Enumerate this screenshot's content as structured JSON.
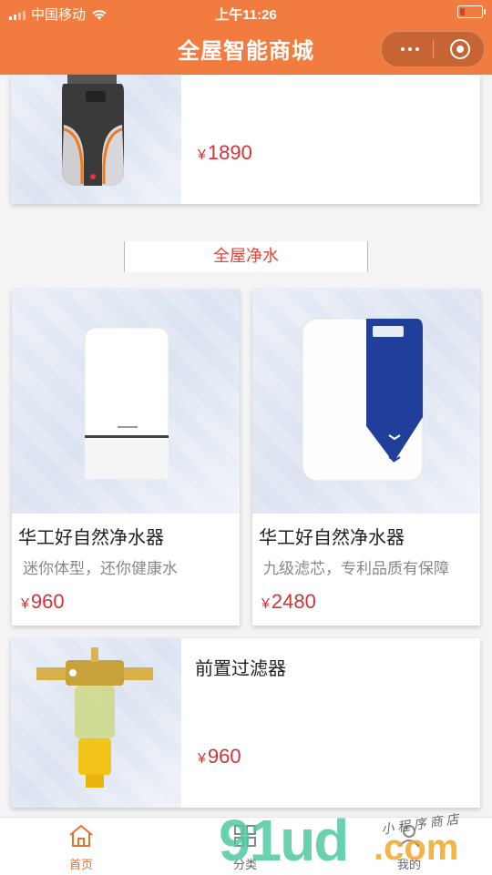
{
  "status": {
    "carrier": "中国移动",
    "time": "上午11:26"
  },
  "nav": {
    "title": "全屋智能商城"
  },
  "products_top": [
    {
      "price_symbol": "¥",
      "price": "1890"
    }
  ],
  "section": {
    "title": "全屋净水"
  },
  "products_grid": [
    {
      "title": "华工好自然净水器",
      "desc": "迷你体型，还你健康水",
      "price_symbol": "¥",
      "price": "960"
    },
    {
      "title": "华工好自然净水器",
      "desc": "九级滤芯，专利品质有保障",
      "price_symbol": "¥",
      "price": "2480"
    }
  ],
  "products_bottom": [
    {
      "title": "前置过滤器",
      "price_symbol": "¥",
      "price": "960"
    }
  ],
  "tabbar": {
    "items": [
      {
        "label": "首页"
      },
      {
        "label": "分类"
      },
      {
        "label": "我的"
      }
    ]
  },
  "watermark": {
    "brand": "91ud",
    "tld": ".com",
    "tagline": "小 程 序 商 店"
  },
  "colors": {
    "header": "#f27c3f",
    "price": "#d0343a",
    "section_title": "#e6453a",
    "tab_active": "#e8712f"
  }
}
